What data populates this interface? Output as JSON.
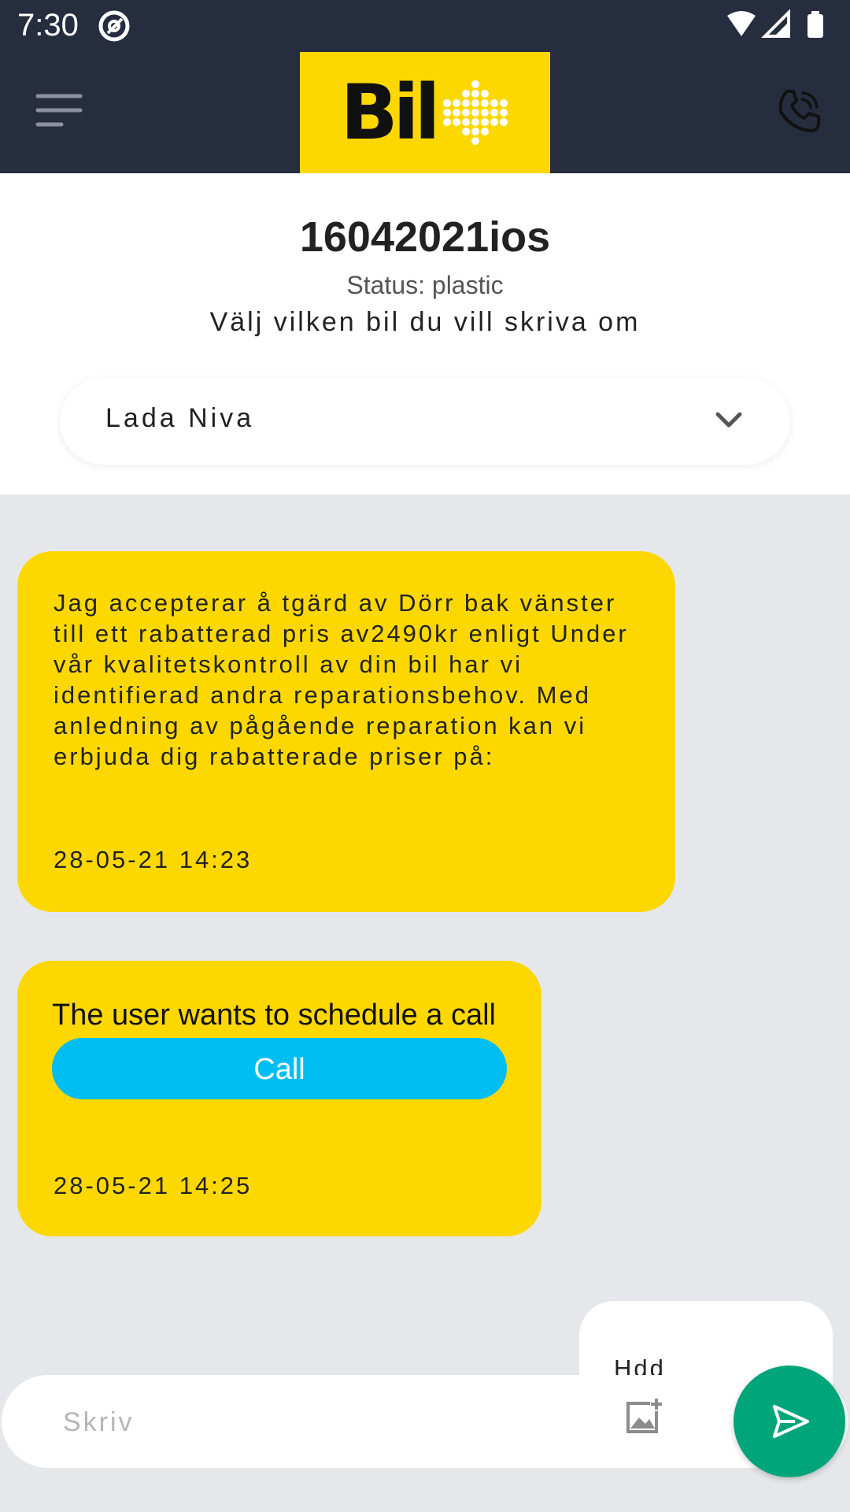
{
  "status_bar": {
    "time": "7:30"
  },
  "app_bar": {
    "logo_text": "Bil"
  },
  "header": {
    "car_id": "16042021ios",
    "status": "Status: plastic",
    "choose_prompt": "Välj vilken bil du vill skriva om",
    "selected_car": "Lada Niva"
  },
  "messages": [
    {
      "text": "Jag accepterar å tgärd av Dörr bak vänster till ett rabatterad pris av2490kr enligt Under vår kvalitetskontroll av din bil har vi identifierad andra reparationsbehov. Med anledning av pågående reparation kan vi erbjuda dig rabatterade priser på:",
      "timestamp": "28-05-21 14:23"
    },
    {
      "text": "The user wants to schedule a call",
      "button_label": "Call",
      "timestamp": "28-05-21 14:25"
    },
    {
      "text": "Hdd"
    }
  ],
  "composer": {
    "placeholder": "Skriv"
  },
  "colors": {
    "appbar": "#262d3f",
    "brand_yellow": "#fdd800",
    "call_blue": "#00bdf2",
    "send_green": "#00a57a",
    "chat_bg": "#e6e7ea"
  },
  "icons": {
    "menu": "hamburger-menu-icon",
    "phone": "phone-icon",
    "dropdown": "chevron-down-icon",
    "attach": "add-photo-icon",
    "send": "send-icon"
  }
}
